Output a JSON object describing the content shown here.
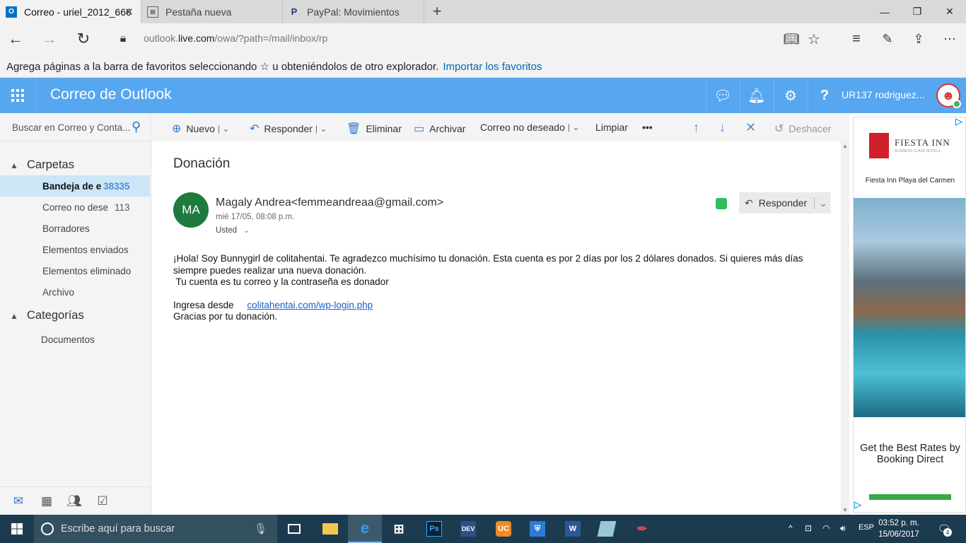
{
  "browser": {
    "tabs": [
      {
        "label": "Correo - uriel_2012_666",
        "icon": "outlook-icon",
        "active": true
      },
      {
        "label": "Pestaña nueva",
        "icon": "new-tab-icon",
        "active": false
      },
      {
        "label": "PayPal: Movimientos",
        "icon": "paypal-icon",
        "active": false
      }
    ],
    "url_prefix": "outlook.",
    "url_domain": "live.com",
    "url_path": "/owa/?path=/mail/inbox/rp",
    "favorites_message": "Agrega páginas a la barra de favoritos seleccionando ☆ u obteniéndolos de otro explorador.",
    "favorites_link": "Importar los favoritos"
  },
  "app": {
    "title": "Correo de Outlook",
    "user_name": "UR137 rodriguez...",
    "accent_color": "#57a6f0"
  },
  "sidebar": {
    "search_placeholder": "Buscar en Correo y Conta...",
    "folders_header": "Carpetas",
    "folders": [
      {
        "label": "Bandeja de e",
        "count": "38335",
        "selected": true
      },
      {
        "label": "Correo no dese",
        "count": "113",
        "selected": false
      },
      {
        "label": "Borradores",
        "count": "",
        "selected": false
      },
      {
        "label": "Elementos enviados",
        "count": "",
        "selected": false
      },
      {
        "label": "Elementos eliminado",
        "count": "",
        "selected": false
      },
      {
        "label": "Archivo",
        "count": "",
        "selected": false
      }
    ],
    "categories_header": "Categorías",
    "categories": [
      {
        "label": "Documentos"
      }
    ]
  },
  "toolbar": {
    "new_label": "Nuevo",
    "reply_label": "Responder",
    "delete_label": "Eliminar",
    "archive_label": "Archivar",
    "junk_label": "Correo no deseado",
    "sweep_label": "Limpiar",
    "more_label": "•••",
    "undo_label": "Deshacer"
  },
  "message": {
    "subject": "Donación",
    "sender_initials": "MA",
    "sender": "Magaly Andrea<femmeandreaa@gmail.com>",
    "date": "mié 17/05, 08:08 p.m.",
    "recipient": "Usted",
    "reply_label": "Responder",
    "body_line1": "¡Hola! Soy Bunnygirl de colitahentai. Te agradezco muchísimo tu donación. Esta cuenta es por 2 días por los 2 dólares donados. Si quieres más días siempre puedes realizar una nueva donación.",
    "body_line2": " Tu cuenta es tu correo y la contraseña es donador",
    "body_login_label": "Ingresa desde",
    "body_login_link": "colitahentai.com/wp-login.php",
    "body_thanks": "Gracias por tu donación."
  },
  "ad": {
    "brand": "FIESTA INN",
    "brand_sub": "BUSINESS CLASS HOTELS",
    "hotel": "Fiesta Inn Playa del Carmen",
    "tagline": "Get the Best Rates by Booking Direct"
  },
  "taskbar": {
    "search_placeholder": "Escribe aquí para buscar",
    "language": "ESP",
    "time": "03:52 p. m.",
    "date": "15/06/2017",
    "notifications": "4"
  }
}
